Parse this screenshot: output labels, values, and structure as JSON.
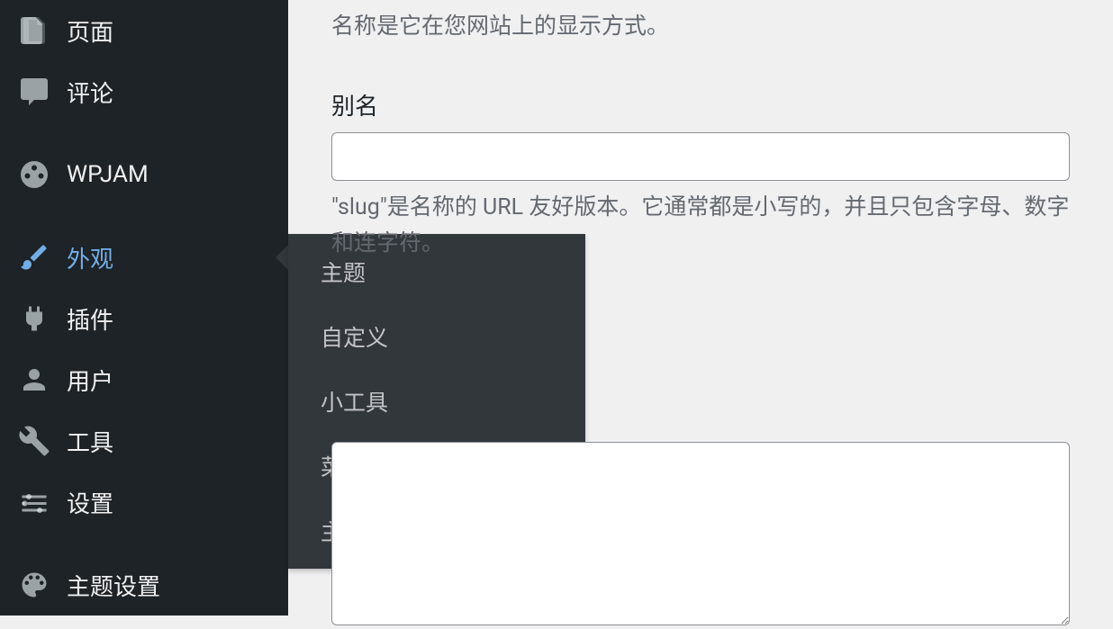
{
  "sidebar": {
    "items": [
      {
        "label": "页面",
        "icon": "pages-icon"
      },
      {
        "label": "评论",
        "icon": "comments-icon"
      },
      {
        "label": "WPJAM",
        "icon": "gauge-icon"
      },
      {
        "label": "外观",
        "icon": "brush-icon",
        "active": true
      },
      {
        "label": "插件",
        "icon": "plugin-icon"
      },
      {
        "label": "用户",
        "icon": "user-icon"
      },
      {
        "label": "工具",
        "icon": "wrench-icon"
      },
      {
        "label": "设置",
        "icon": "settings-icon"
      },
      {
        "label": "主题设置",
        "icon": "palette-icon"
      }
    ]
  },
  "submenu": {
    "items": [
      {
        "label": "主题"
      },
      {
        "label": "自定义"
      },
      {
        "label": "小工具"
      },
      {
        "label": "菜单"
      },
      {
        "label": "主题文件编辑器"
      }
    ]
  },
  "form": {
    "name_help": "名称是它在您网站上的显示方式。",
    "slug_label": "别名",
    "slug_help": "\"slug\"是名称的 URL 友好版本。它通常都是小写的，并且只包含字母、数字和连字符。"
  }
}
